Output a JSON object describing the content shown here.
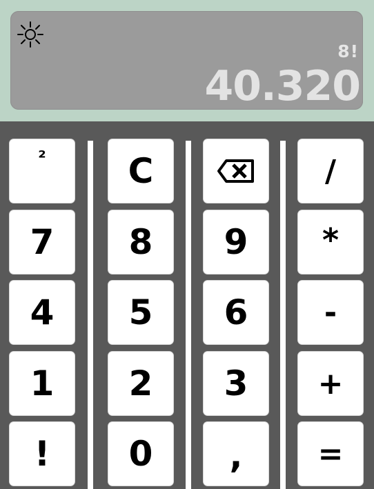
{
  "display": {
    "brightness_icon": "sun-icon",
    "expression": "8!",
    "result": "40.320"
  },
  "keys": {
    "square": "²",
    "clear": "C",
    "backspace_icon": "backspace-icon",
    "divide": "/",
    "seven": "7",
    "eight": "8",
    "nine": "9",
    "multiply": "*",
    "four": "4",
    "five": "5",
    "six": "6",
    "minus": "-",
    "one": "1",
    "two": "2",
    "three": "3",
    "plus": "+",
    "factorial": "!",
    "zero": "0",
    "comma": ",",
    "equals": "="
  },
  "colors": {
    "background": "#595959",
    "top_band": "#bcd4c6",
    "display": "#9b9b9b",
    "display_text": "#e3e3e3",
    "key": "#ffffff",
    "key_text": "#000000"
  }
}
